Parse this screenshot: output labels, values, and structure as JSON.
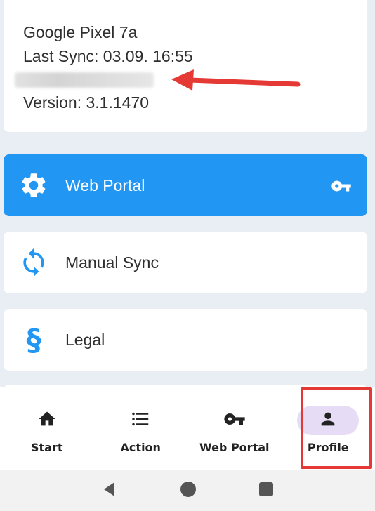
{
  "info": {
    "device": "Google Pixel 7a",
    "last_sync": "Last Sync: 03.09. 16:55",
    "version": "Version: 3.1.1470"
  },
  "menu": {
    "items": [
      {
        "label": "Web Portal",
        "icon": "gear-icon",
        "trailing_icon": "key-icon"
      },
      {
        "label": "Manual Sync",
        "icon": "sync-icon"
      },
      {
        "label": "Legal",
        "icon": "section-icon"
      }
    ]
  },
  "bottom_nav": {
    "items": [
      {
        "label": "Start",
        "icon": "home-icon"
      },
      {
        "label": "Action",
        "icon": "list-icon"
      },
      {
        "label": "Web Portal",
        "icon": "key-icon"
      },
      {
        "label": "Profile",
        "icon": "person-icon",
        "selected": true
      }
    ]
  },
  "colors": {
    "accent": "#2196f3",
    "background": "#e9edf4",
    "selected_pill": "#e6dcf5",
    "annotation_red": "#e53935"
  }
}
